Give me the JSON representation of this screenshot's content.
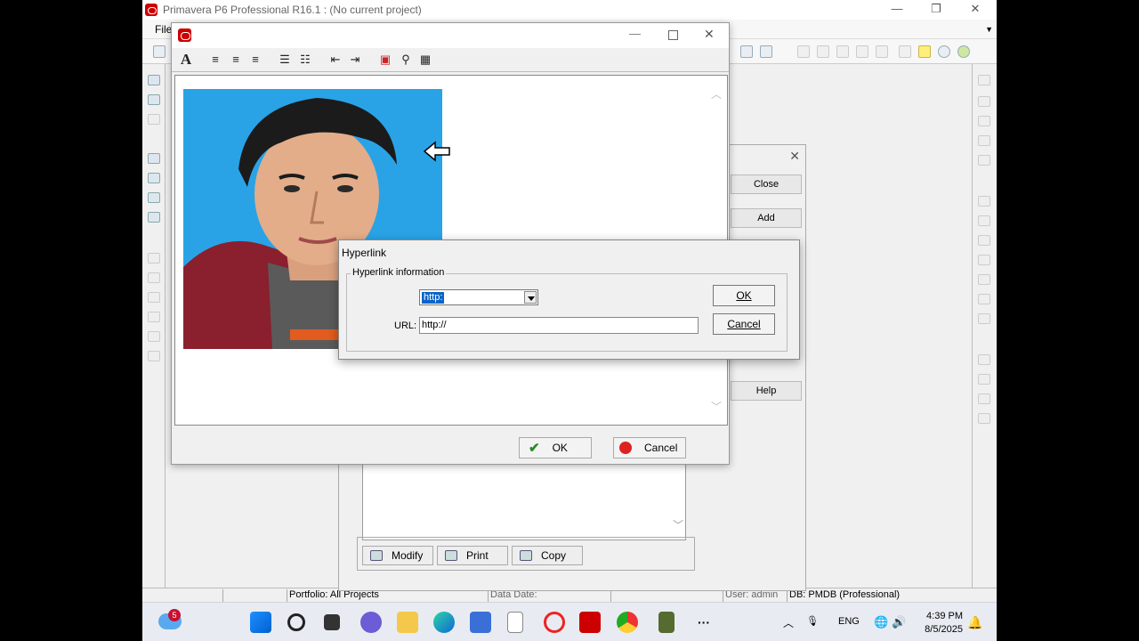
{
  "app": {
    "title": "Primavera P6 Professional R16.1 : (No current project)",
    "menu_first": "File",
    "minimize": "—",
    "maximize": "❐",
    "close": "✕"
  },
  "statusbar": {
    "portfolio": "Portfolio: All Projects",
    "data_date": "Data Date:",
    "user": "User: admin",
    "db": "DB: PMDB (Professional)"
  },
  "bg_dialog": {
    "close_label": "Close",
    "add_label": "Add",
    "help_label": "Help",
    "modify_label": "Modify",
    "print_label": "Print",
    "copy_label": "Copy"
  },
  "editor": {
    "ok_label": "OK",
    "cancel_label": "Cancel",
    "font_glyph": "A"
  },
  "hyperlink": {
    "title": "Hyperlink",
    "group_label": "Hyperlink information",
    "protocol_value": "http:",
    "url_label": "URL:",
    "url_value": "http://",
    "ok_label": "OK",
    "cancel_label": "Cancel"
  },
  "taskbar": {
    "notification_count": "5",
    "lang": "ENG",
    "time": "4:39 PM",
    "date": "8/5/2025"
  }
}
